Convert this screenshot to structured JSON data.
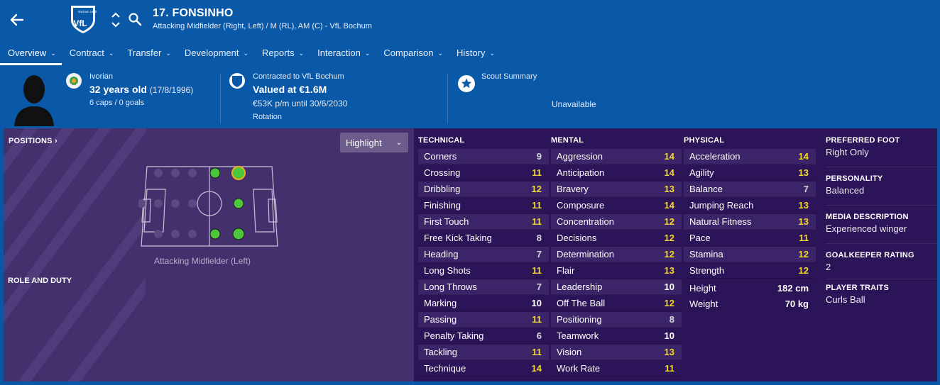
{
  "header": {
    "name": "17. FONSINHO",
    "subtitle": "Attacking Midfielder (Right, Left) / M (RL), AM (C) - VfL Bochum",
    "crest_text": "Bochum 1848",
    "crest_monogram": "VfL"
  },
  "tabs": [
    {
      "label": "Overview",
      "active": true
    },
    {
      "label": "Contract"
    },
    {
      "label": "Transfer"
    },
    {
      "label": "Development"
    },
    {
      "label": "Reports"
    },
    {
      "label": "Interaction"
    },
    {
      "label": "Comparison"
    },
    {
      "label": "History"
    }
  ],
  "info": {
    "nationality": "Ivorian",
    "age": "32 years old",
    "dob": "(17/8/1996)",
    "caps": "6 caps / 0 goals",
    "contract_club": "Contracted to VfL Bochum",
    "value": "Valued at €1.6M",
    "wage": "€53K p/m until 30/6/2030",
    "squad_status": "Rotation",
    "scout_label": "Scout Summary",
    "scout_value": "Unavailable"
  },
  "positions": {
    "title": "POSITIONS ›",
    "highlight_label": "Highlight",
    "caption": "Attacking Midfielder (Left)",
    "role_title": "ROLE AND DUTY"
  },
  "technical": {
    "title": "TECHNICAL",
    "items": [
      {
        "label": "Corners",
        "value": "9"
      },
      {
        "label": "Crossing",
        "value": "11"
      },
      {
        "label": "Dribbling",
        "value": "12"
      },
      {
        "label": "Finishing",
        "value": "11"
      },
      {
        "label": "First Touch",
        "value": "11"
      },
      {
        "label": "Free Kick Taking",
        "value": "8"
      },
      {
        "label": "Heading",
        "value": "7"
      },
      {
        "label": "Long Shots",
        "value": "11"
      },
      {
        "label": "Long Throws",
        "value": "7"
      },
      {
        "label": "Marking",
        "value": "10"
      },
      {
        "label": "Passing",
        "value": "11"
      },
      {
        "label": "Penalty Taking",
        "value": "6"
      },
      {
        "label": "Tackling",
        "value": "11"
      },
      {
        "label": "Technique",
        "value": "14"
      }
    ]
  },
  "mental": {
    "title": "MENTAL",
    "items": [
      {
        "label": "Aggression",
        "value": "14"
      },
      {
        "label": "Anticipation",
        "value": "14"
      },
      {
        "label": "Bravery",
        "value": "13"
      },
      {
        "label": "Composure",
        "value": "14"
      },
      {
        "label": "Concentration",
        "value": "12"
      },
      {
        "label": "Decisions",
        "value": "12"
      },
      {
        "label": "Determination",
        "value": "12"
      },
      {
        "label": "Flair",
        "value": "13"
      },
      {
        "label": "Leadership",
        "value": "10"
      },
      {
        "label": "Off The Ball",
        "value": "12"
      },
      {
        "label": "Positioning",
        "value": "8"
      },
      {
        "label": "Teamwork",
        "value": "10"
      },
      {
        "label": "Vision",
        "value": "13"
      },
      {
        "label": "Work Rate",
        "value": "11"
      }
    ]
  },
  "physical": {
    "title": "PHYSICAL",
    "items": [
      {
        "label": "Acceleration",
        "value": "14"
      },
      {
        "label": "Agility",
        "value": "13"
      },
      {
        "label": "Balance",
        "value": "7"
      },
      {
        "label": "Jumping Reach",
        "value": "13"
      },
      {
        "label": "Natural Fitness",
        "value": "13"
      },
      {
        "label": "Pace",
        "value": "11"
      },
      {
        "label": "Stamina",
        "value": "12"
      },
      {
        "label": "Strength",
        "value": "12"
      }
    ],
    "height_label": "Height",
    "height": "182 cm",
    "weight_label": "Weight",
    "weight": "70 kg"
  },
  "meta": [
    {
      "title": "PREFERRED FOOT",
      "value": "Right Only"
    },
    {
      "title": "PERSONALITY",
      "value": "Balanced"
    },
    {
      "title": "MEDIA DESCRIPTION",
      "value": "Experienced winger"
    },
    {
      "title": "GOALKEEPER RATING",
      "value": "2"
    },
    {
      "title": "PLAYER TRAITS",
      "value": "Curls Ball"
    }
  ],
  "colors": {
    "header_blue": "#0a58a8",
    "panel_purple": "#2c1458",
    "highlight_yellow": "#f5d928",
    "position_green": "#4cc63a"
  }
}
